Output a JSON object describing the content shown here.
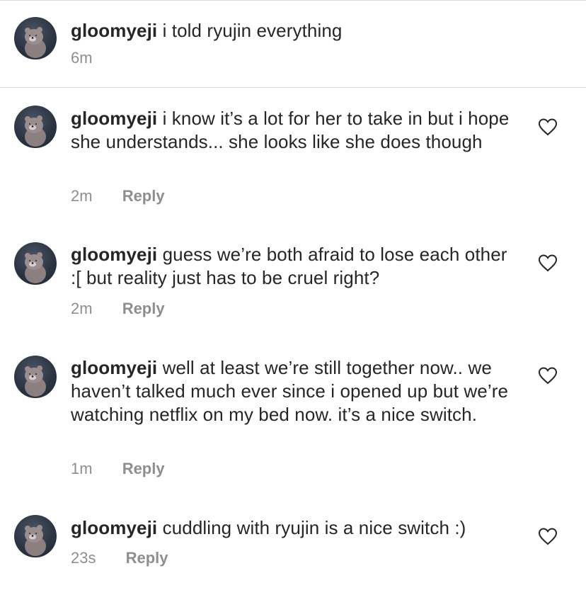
{
  "caption": {
    "username": "gloomyeji",
    "text": "i told ryujin everything",
    "time": "6m"
  },
  "comments": [
    {
      "username": "gloomyeji",
      "text": "i know it’s a lot for her to take in but i hope she understands... she looks like she does though",
      "time": "2m",
      "reply_label": "Reply"
    },
    {
      "username": "gloomyeji",
      "text": "guess we’re both afraid to lose each other :[ but reality just has to be cruel right?",
      "time": "2m",
      "reply_label": "Reply"
    },
    {
      "username": "gloomyeji",
      "text": "well at least we’re still together now.. we haven’t talked much ever since i opened up but we’re watching netflix on my bed now. it’s a nice switch.",
      "time": "1m",
      "reply_label": "Reply"
    },
    {
      "username": "gloomyeji",
      "text": "cuddling with ryujin is a nice switch :)",
      "time": "23s",
      "reply_label": "Reply"
    }
  ],
  "icons": {
    "avatar": "bear-avatar-icon",
    "like": "heart-outline-icon"
  },
  "colors": {
    "text": "#262626",
    "muted": "#8e8e8e",
    "divider": "#dbdbdb"
  }
}
